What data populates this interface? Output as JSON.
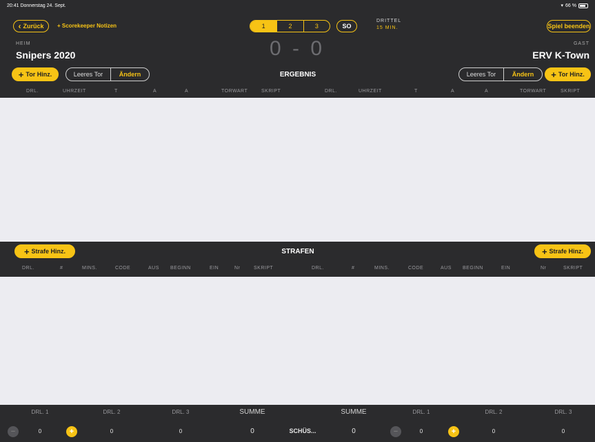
{
  "status_bar": {
    "time_date": "20:41  Donnerstag 24. Sept.",
    "battery": "66 %"
  },
  "top": {
    "back_label": "Zurück",
    "notes_label": "+ Scorekeeper Notizen",
    "periods": [
      "1",
      "2",
      "3"
    ],
    "so_label": "SO",
    "period_title": "DRITTEL",
    "period_sub": "15 MIN.",
    "end_game_label": "Spiel beenden"
  },
  "home": {
    "label": "HEIM",
    "name": "Snipers 2020"
  },
  "away": {
    "label": "GAST",
    "name": "ERV K-Town"
  },
  "score": "0 - 0",
  "result": {
    "add_goal_label": "Tor Hinz.",
    "empty_net_label": "Leeres Tor",
    "change_label": "Ändern",
    "title": "ERGEBNIS",
    "columns": [
      "DRL.",
      "UHRZEIT",
      "T",
      "A",
      "A",
      "TORWART",
      "SKRIPT"
    ]
  },
  "penalties": {
    "add_label": "Strafe Hinz.",
    "title": "STRAFEN",
    "columns": [
      "DRL.",
      "#",
      "MINS.",
      "CODE",
      "AUS",
      "BEGINN",
      "EIN",
      "Nr",
      "SKRIPT"
    ]
  },
  "shots": {
    "headers": [
      "DRL. 1",
      "DRL. 2",
      "DRL. 3",
      "SUMME",
      "SUMME",
      "DRL. 1",
      "DRL. 2",
      "DRL. 3"
    ],
    "home_values": [
      "0",
      "0",
      "0",
      "0"
    ],
    "away_values": [
      "0",
      "0",
      "0",
      "0"
    ],
    "label": "SCHÜS..."
  },
  "colors": {
    "accent": "#f7c315",
    "dark": "#2b2b2d",
    "panel": "#ececf1"
  }
}
